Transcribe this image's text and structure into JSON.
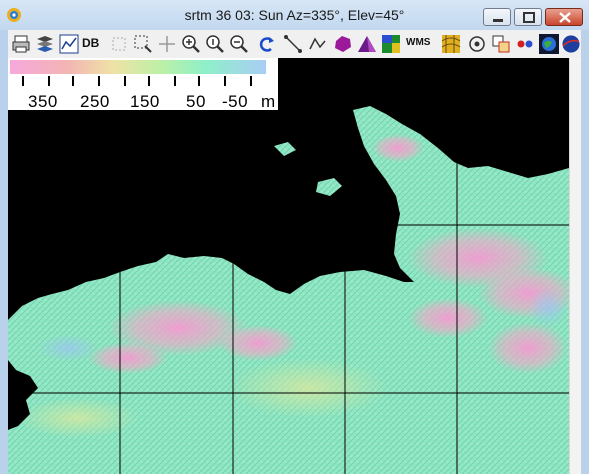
{
  "window": {
    "title": "srtm 36 03: Sun Az=335°, Elev=45°"
  },
  "toolbar": {
    "db_label": "DB",
    "wms_label": "WMS",
    "icons": [
      "print-icon",
      "layers-icon",
      "graph-icon",
      "database-icon",
      "select-box-icon",
      "zoom-box-icon",
      "crosshair-icon",
      "zoom-in-icon",
      "zoom-fit-icon",
      "zoom-out-icon",
      "refresh-icon",
      "measure-line-icon",
      "measure-path-icon",
      "polygon-icon",
      "mountain-icon",
      "map-icon",
      "wms-icon",
      "grid-map-icon",
      "target-icon",
      "overlay-icon",
      "rgb-icon",
      "globe-icon",
      "nasa-icon"
    ]
  },
  "legend": {
    "labels": [
      "350",
      "250",
      "150",
      "50",
      "-50",
      "m"
    ]
  },
  "colors": {
    "ocean": "#000000",
    "low": "#8ff0c8",
    "high": "#f39ad2",
    "grid": "#000000"
  }
}
